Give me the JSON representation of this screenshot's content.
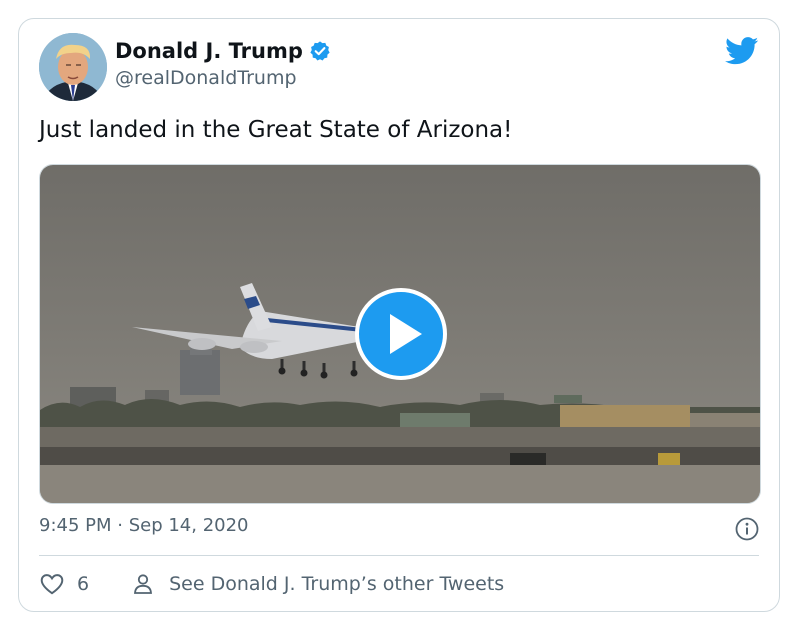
{
  "tweet": {
    "author_name": "Donald J. Trump",
    "author_handle": "@realDonaldTrump",
    "text": "Just landed in the Great State of Arizona!",
    "timestamp": "9:45 PM · Sep 14, 2020",
    "like_count": "6",
    "more_tweets_label": "See Donald J. Trump’s other Tweets",
    "verified": true
  },
  "icons": {
    "brand": "twitter-bird-icon",
    "verified": "verified-badge-icon",
    "play": "play-icon",
    "info": "info-icon",
    "like": "heart-icon",
    "profile": "person-icon"
  },
  "colors": {
    "accent": "#1d9bf0",
    "text": "#0f1419",
    "secondary_text": "#536471",
    "border": "#cfd9de"
  }
}
